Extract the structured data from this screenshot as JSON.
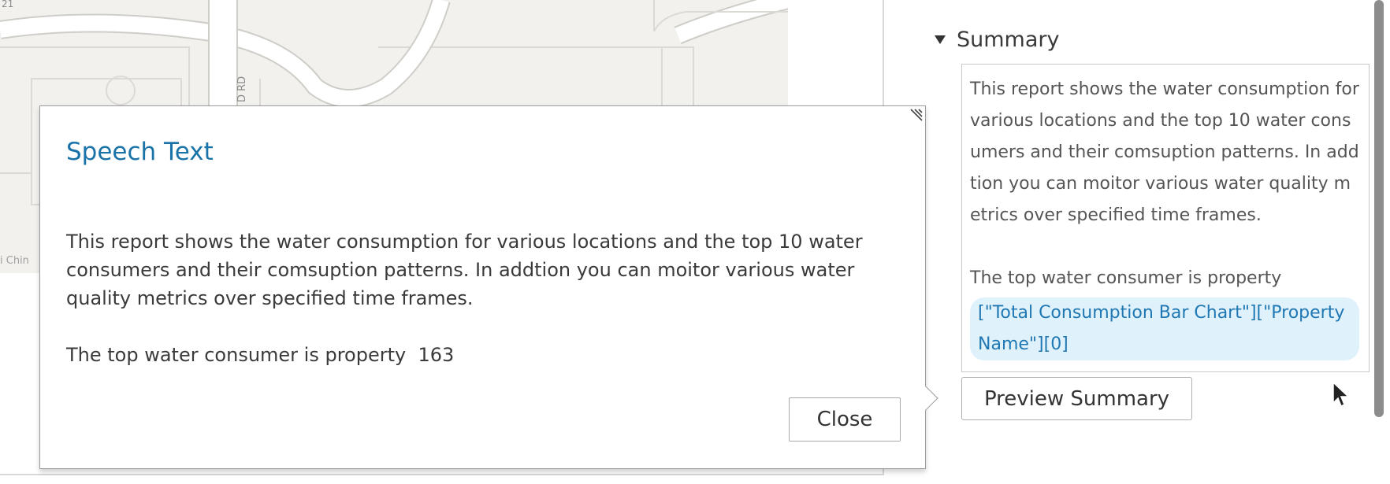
{
  "map": {
    "road_label": "D RD",
    "corner_label": "21",
    "attribution": "i Chin"
  },
  "summary": {
    "header": "Summary",
    "paragraph": "This report shows the water consumption for various locations and the top 10 water consumers and their comsuption patterns. In addtion you can moitor various water quality metrics over specified time frames.",
    "consumer_prefix": "The top water consumer is property",
    "token": "[\"Total Consumption Bar Chart\"][\"Property Name\"][0]",
    "preview_button": "Preview Summary"
  },
  "popup": {
    "title": "Speech Text",
    "paragraph": "This report shows the water consumption for various locations and the top 10 water consumers and their comsuption patterns. In addtion you can moitor various water quality metrics over specified time frames.",
    "consumer_line": "The top water consumer is property  163",
    "close_button": "Close"
  },
  "colors": {
    "accent": "#1a73a8",
    "token_bg": "#dff1fb",
    "map_bg": "#f2f1ee"
  }
}
